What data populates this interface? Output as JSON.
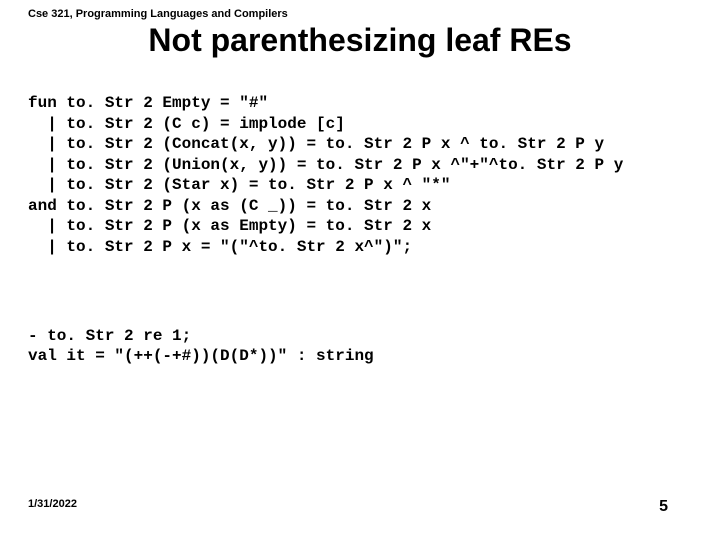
{
  "header": "Cse 321, Programming Languages and Compilers",
  "title": "Not parenthesizing leaf REs",
  "code": {
    "l1": "fun to. Str 2 Empty = \"#\"",
    "l2": "  | to. Str 2 (C c) = implode [c]",
    "l3": "  | to. Str 2 (Concat(x, y)) = to. Str 2 P x ^ to. Str 2 P y",
    "l4": "  | to. Str 2 (Union(x, y)) = to. Str 2 P x ^\"+\"^to. Str 2 P y",
    "l5": "  | to. Str 2 (Star x) = to. Str 2 P x ^ \"*\"",
    "l6": "and to. Str 2 P (x as (C _)) = to. Str 2 x",
    "l7": "  | to. Str 2 P (x as Empty) = to. Str 2 x",
    "l8": "  | to. Str 2 P x = \"(\"^to. Str 2 x^\")\";"
  },
  "code2": {
    "l1": "- to. Str 2 re 1;",
    "l2": "val it = \"(++(-+#))(D(D*))\" : string"
  },
  "footer": {
    "date": "1/31/2022",
    "page": "5"
  }
}
